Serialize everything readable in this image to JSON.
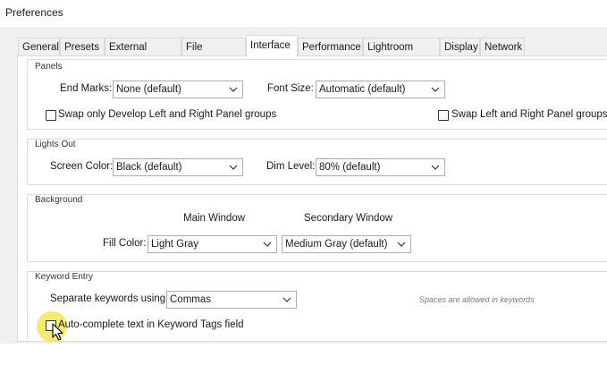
{
  "window": {
    "title": "Preferences"
  },
  "tabs": [
    {
      "label": "General"
    },
    {
      "label": "Presets"
    },
    {
      "label": "External Editing"
    },
    {
      "label": "File Handling"
    },
    {
      "label": "Interface"
    },
    {
      "label": "Performance"
    },
    {
      "label": "Lightroom Sync"
    },
    {
      "label": "Display"
    },
    {
      "label": "Network"
    }
  ],
  "active_tab": "Interface",
  "panels": {
    "title": "Panels",
    "end_marks_label": "End Marks:",
    "end_marks_value": "None (default)",
    "font_size_label": "Font Size:",
    "font_size_value": "Automatic (default)",
    "swap_develop_label": "Swap only Develop Left and Right Panel groups",
    "swap_develop_checked": false,
    "swap_all_label": "Swap Left and Right Panel groups",
    "swap_all_checked": false
  },
  "lights_out": {
    "title": "Lights Out",
    "screen_color_label": "Screen Color:",
    "screen_color_value": "Black (default)",
    "dim_level_label": "Dim Level:",
    "dim_level_value": "80% (default)"
  },
  "background": {
    "title": "Background",
    "main_window_header": "Main Window",
    "secondary_window_header": "Secondary Window",
    "fill_color_label": "Fill Color:",
    "main_fill_value": "Light Gray",
    "secondary_fill_value": "Medium Gray (default)"
  },
  "keyword_entry": {
    "title": "Keyword Entry",
    "separate_label": "Separate keywords using:",
    "separate_value": "Commas",
    "hint": "Spaces are allowed in keywords",
    "autocomplete_label": "Auto-complete text in Keyword Tags field",
    "autocomplete_checked": false
  },
  "icons": {
    "dropdown": "chevron-down-icon",
    "pointer": "mouse-pointer-icon"
  },
  "colors": {
    "dialog_bg": "#f0f0f0",
    "page_bg": "#ffffff",
    "cursor_highlight": "#f5e650"
  }
}
